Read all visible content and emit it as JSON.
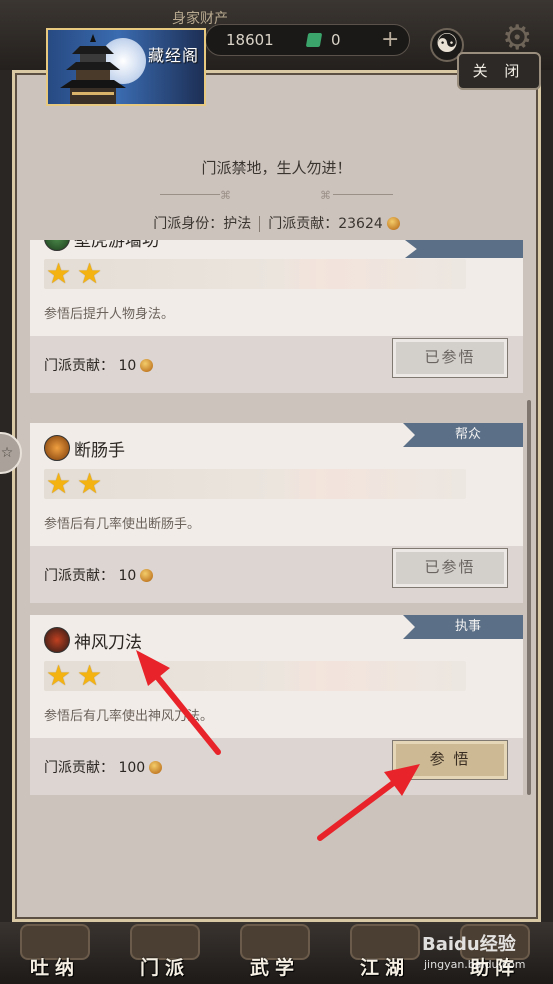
{
  "topbar": {
    "assets_label": "身家财产",
    "money": "18601",
    "gems": "0"
  },
  "modal": {
    "banner_title": "藏经阁",
    "close_label": "关 闭",
    "motto": "门派禁地，生人勿进！",
    "identity_label": "门派身份：护法",
    "contribution_label": "门派贡献：23624"
  },
  "skills": [
    {
      "name": "壁虎游墙功",
      "stars": 2,
      "desc": "参悟后提升人物身法。",
      "cost_label": "门派贡献：",
      "cost": "10",
      "button": "已参悟",
      "rank": ""
    },
    {
      "name": "断肠手",
      "stars": 2,
      "desc": "参悟后有几率使出断肠手。",
      "cost_label": "门派贡献：",
      "cost": "10",
      "button": "已参悟",
      "rank": "帮众"
    },
    {
      "name": "神风刀法",
      "stars": 2,
      "desc": "参悟后有几率使出神风刀法。",
      "cost_label": "门派贡献：",
      "cost": "100",
      "button": "参 悟",
      "rank": "执事"
    }
  ],
  "bottom_tabs": [
    "吐纳",
    "门派",
    "武学",
    "江湖",
    "助阵"
  ],
  "watermark": {
    "brand": "Baidu经验",
    "url": "jingyan.baidu.com"
  },
  "colors": {
    "rank_tag": "#5b6f86",
    "active_button": "#cdb994",
    "star": "#f5b311",
    "arrow": "#e8242a"
  }
}
